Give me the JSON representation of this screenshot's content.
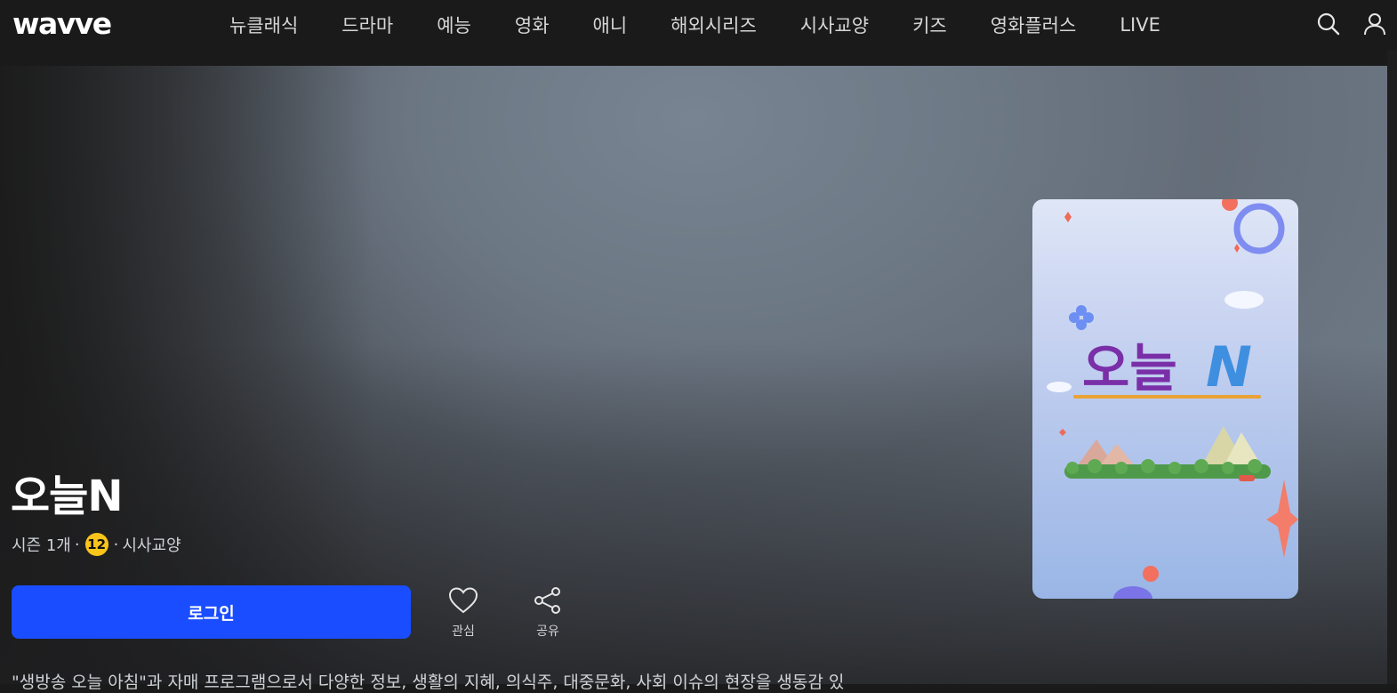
{
  "header": {
    "logo": "wavve",
    "nav": [
      "뉴클래식",
      "드라마",
      "예능",
      "영화",
      "애니",
      "해외시리즈",
      "시사교양",
      "키즈",
      "영화플러스",
      "LIVE"
    ],
    "search_icon": "search-icon",
    "user_icon": "user-icon"
  },
  "program": {
    "title": "오늘N",
    "seasons": "시즌 1개",
    "separator": "·",
    "age_rating": "12",
    "genre": "시사교양",
    "login_label": "로그인",
    "like_label": "관심",
    "share_label": "공유",
    "description": "\"생방송 오늘 아침\"과 자매 프로그램으로서 다양한 정보, 생활의 지혜, 의식주, 대중문화, 사회 이슈의 현장을 생동감 있"
  },
  "poster": {
    "logo_text_main": "오늘",
    "logo_text_accent": "N"
  },
  "colors": {
    "accent": "#1a4dff",
    "age_badge": "#f9c51b",
    "background": "#1a1a1a"
  }
}
